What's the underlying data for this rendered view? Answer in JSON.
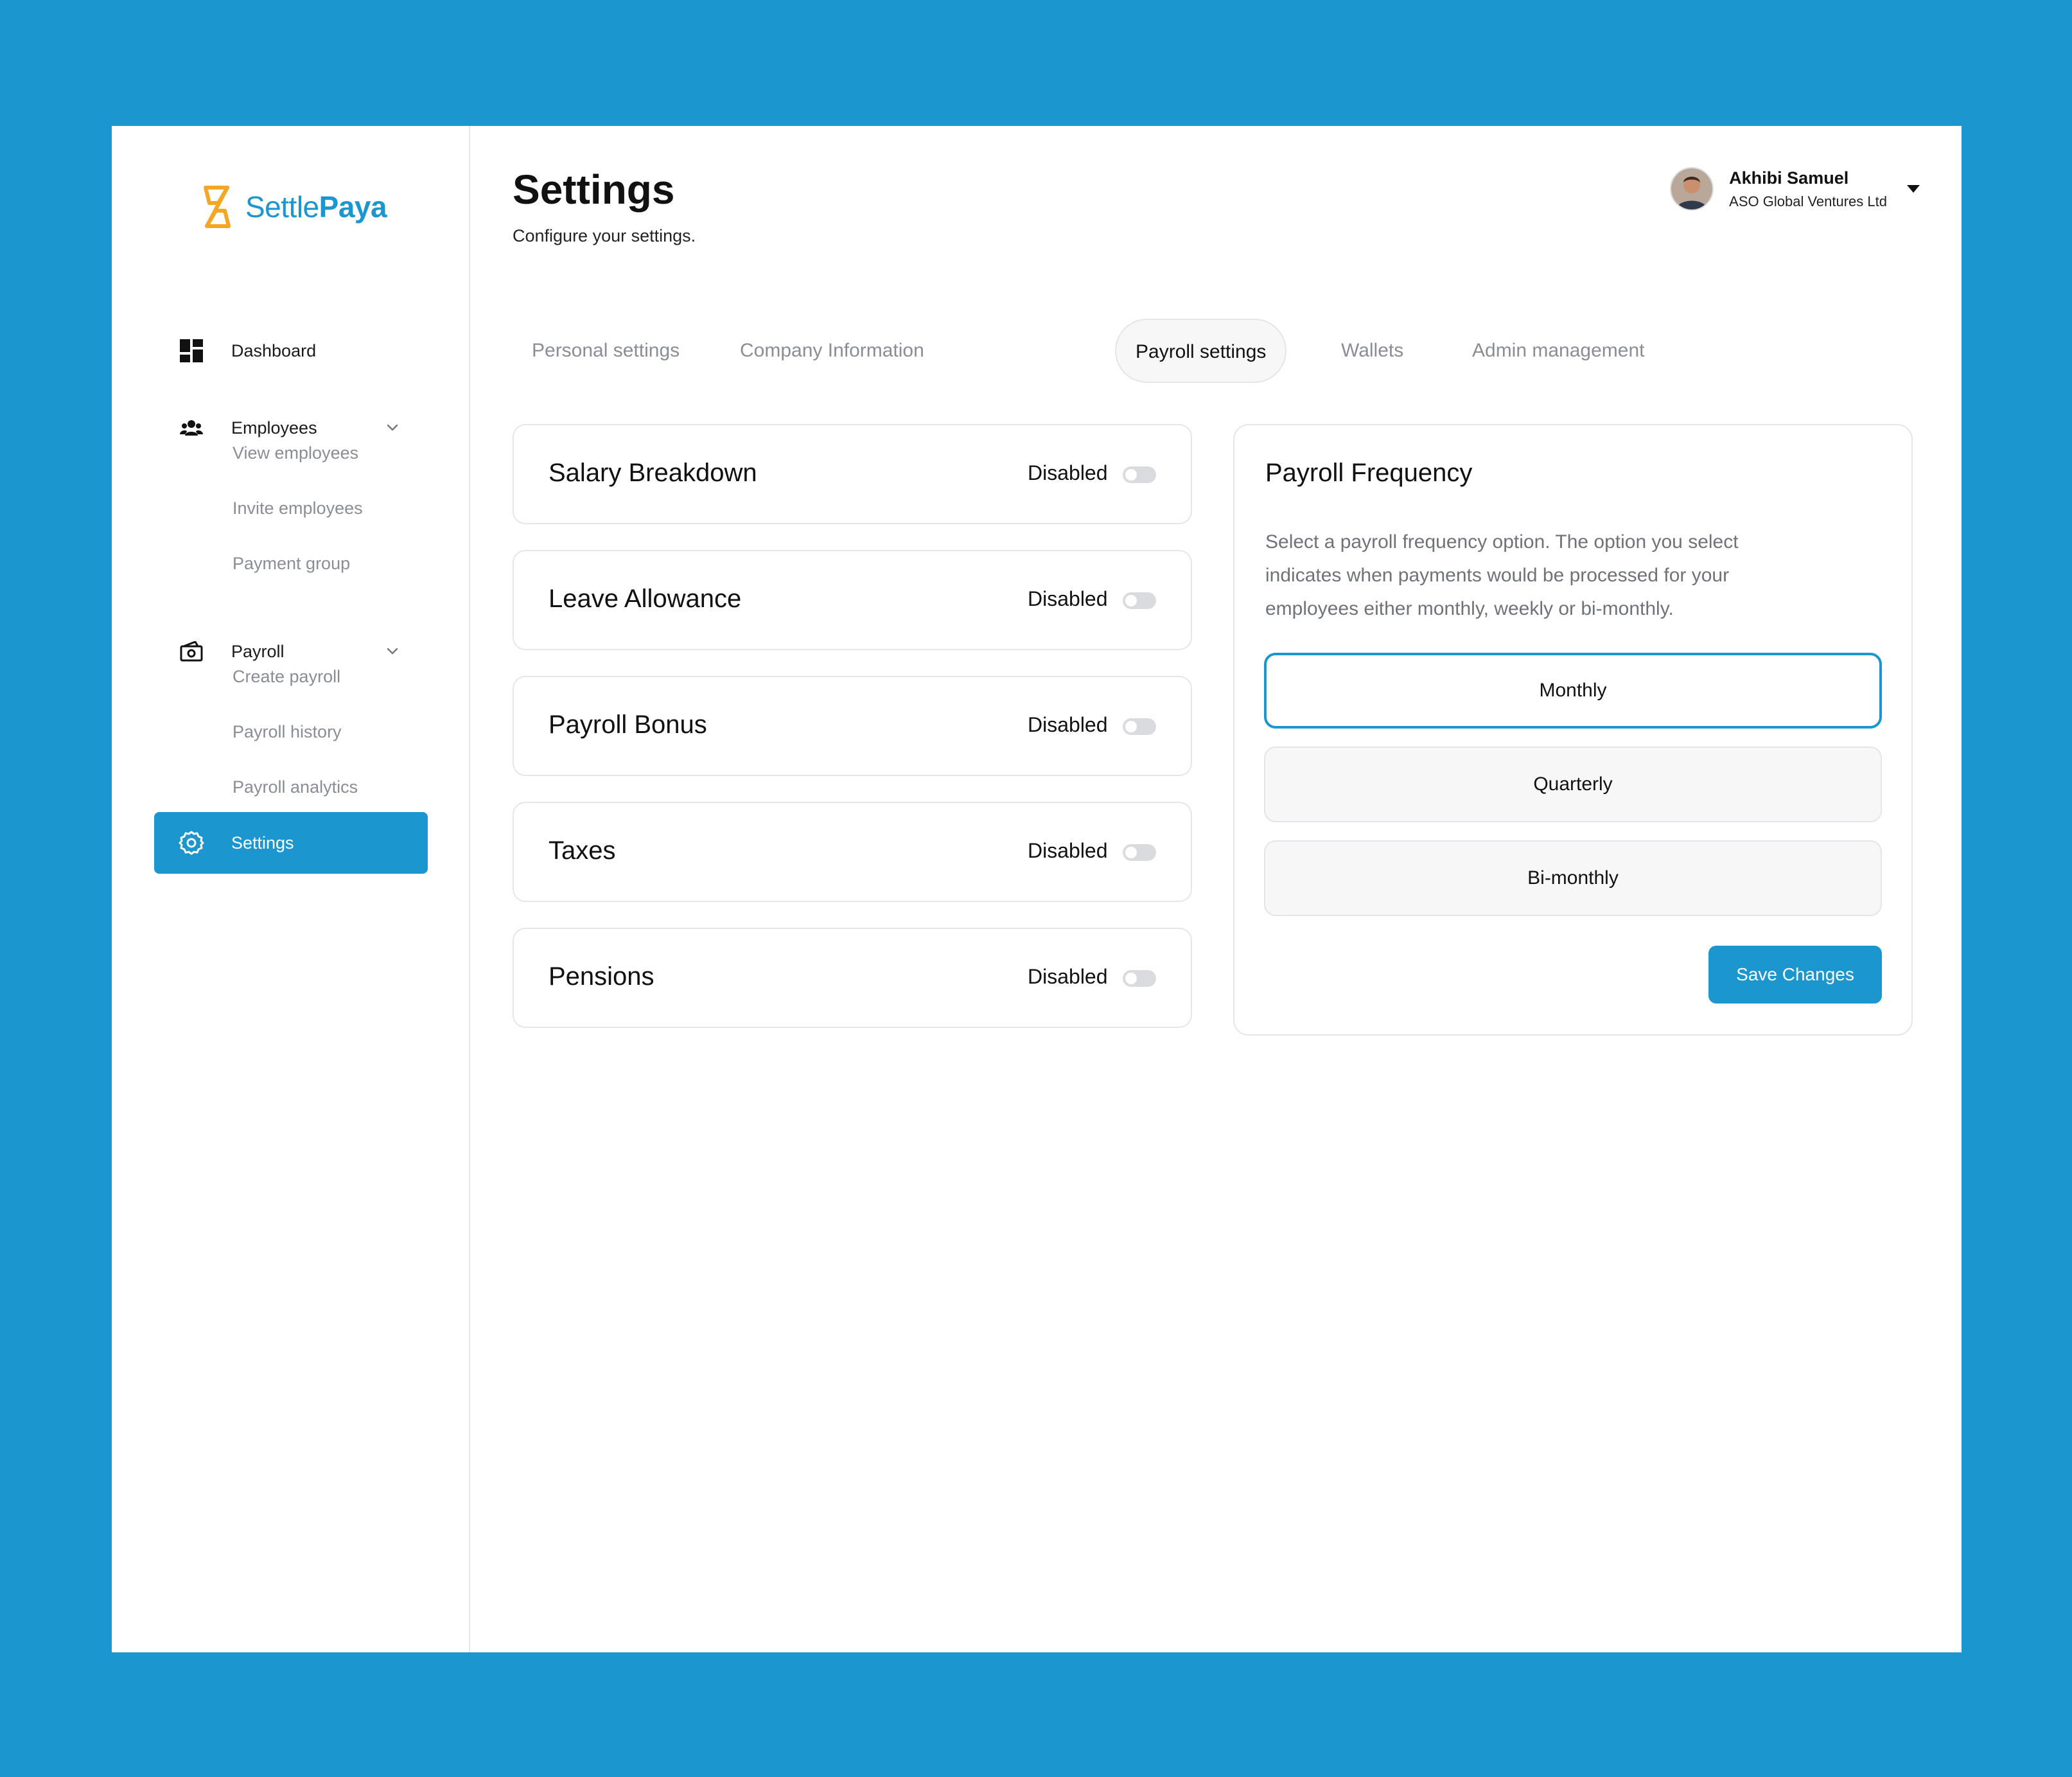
{
  "brand": {
    "name_part1": "Settle",
    "name_part2": "Paya"
  },
  "colors": {
    "accent": "#1b96cf",
    "logo_mark": "#f5a623"
  },
  "sidebar": {
    "dashboard": {
      "label": "Dashboard",
      "icon": "dashboard-grid-icon"
    },
    "employees": {
      "label": "Employees",
      "icon": "users-icon",
      "children": [
        "View employees",
        "Invite employees",
        "Payment group"
      ]
    },
    "payroll": {
      "label": "Payroll",
      "icon": "payroll-cash-icon",
      "children": [
        "Create payroll",
        "Payroll history",
        "Payroll analytics"
      ]
    },
    "settings": {
      "label": "Settings",
      "icon": "gear-icon",
      "active": true
    }
  },
  "header": {
    "title": "Settings",
    "subtitle": "Configure your settings.",
    "user": {
      "name": "Akhibi Samuel",
      "company": "ASO Global Ventures Ltd"
    }
  },
  "tabs": [
    {
      "label": "Personal settings",
      "active": false
    },
    {
      "label": "Company Information",
      "active": false
    },
    {
      "label": "Payroll settings",
      "active": true
    },
    {
      "label": "Wallets",
      "active": false
    },
    {
      "label": "Admin management",
      "active": false
    }
  ],
  "payroll_settings": [
    {
      "title": "Salary Breakdown",
      "status": "Disabled",
      "enabled": false
    },
    {
      "title": "Leave Allowance",
      "status": "Disabled",
      "enabled": false
    },
    {
      "title": "Payroll Bonus",
      "status": "Disabled",
      "enabled": false
    },
    {
      "title": "Taxes",
      "status": "Disabled",
      "enabled": false
    },
    {
      "title": "Pensions",
      "status": "Disabled",
      "enabled": false
    }
  ],
  "frequency": {
    "title": "Payroll Frequency",
    "description": "Select a payroll frequency option. The option you select indicates when payments would be processed for your employees either monthly, weekly or bi-monthly.",
    "options": [
      {
        "label": "Monthly",
        "selected": true
      },
      {
        "label": "Quarterly",
        "selected": false
      },
      {
        "label": "Bi-monthly",
        "selected": false
      }
    ],
    "save_label": "Save Changes"
  }
}
